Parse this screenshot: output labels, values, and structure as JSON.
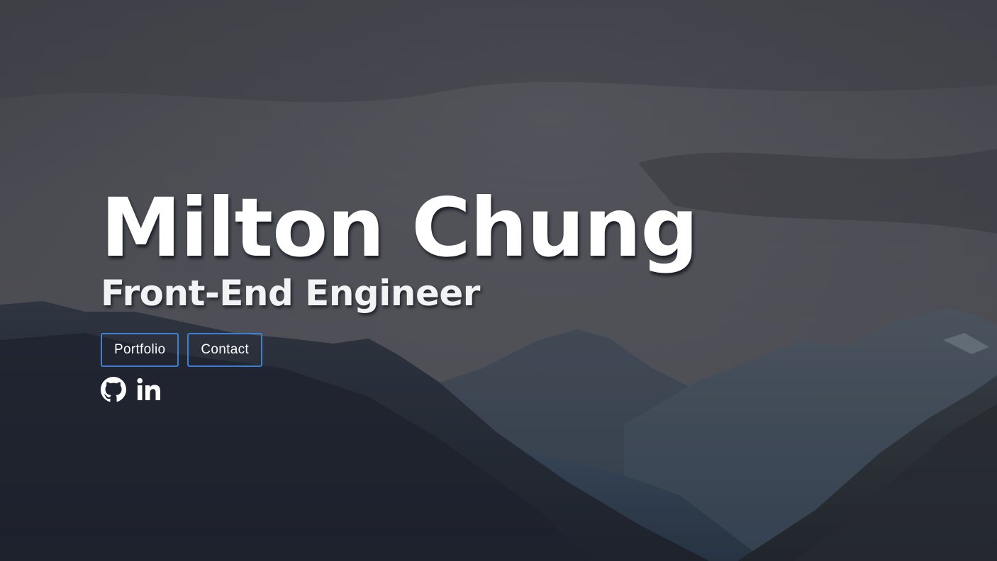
{
  "hero": {
    "name": "Milton Chung",
    "title": "Front-End Engineer"
  },
  "buttons": {
    "portfolio_label": "Portfolio",
    "contact_label": "Contact"
  },
  "socials": [
    {
      "icon": "github-icon"
    },
    {
      "icon": "linkedin-icon"
    }
  ],
  "colors": {
    "button_border": "#3f7fd3",
    "text": "#ffffff"
  }
}
